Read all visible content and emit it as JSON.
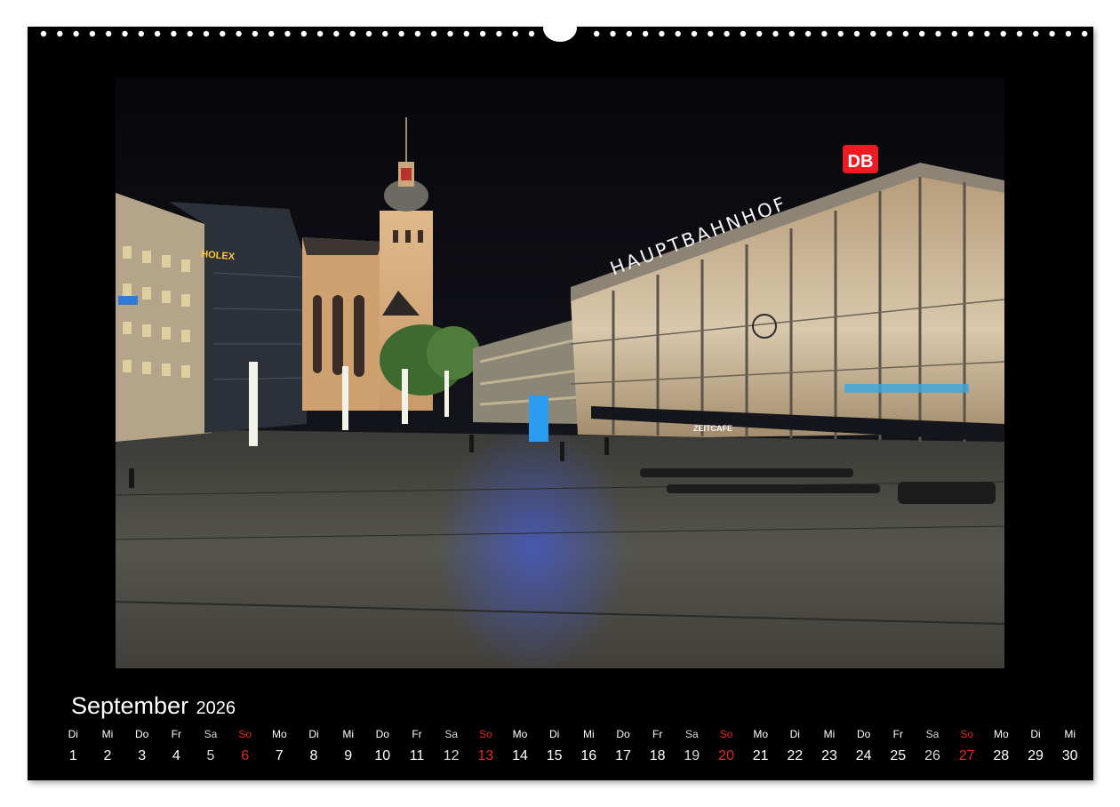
{
  "calendar": {
    "month": "September",
    "year": "2026",
    "colors": {
      "background": "#000000",
      "text": "#ffffff",
      "sunday": "#e32626"
    },
    "days": [
      {
        "weekday": "Di",
        "day": "1",
        "type": "weekday"
      },
      {
        "weekday": "Mi",
        "day": "2",
        "type": "weekday"
      },
      {
        "weekday": "Do",
        "day": "3",
        "type": "weekday"
      },
      {
        "weekday": "Fr",
        "day": "4",
        "type": "weekday"
      },
      {
        "weekday": "Sa",
        "day": "5",
        "type": "saturday"
      },
      {
        "weekday": "So",
        "day": "6",
        "type": "sunday"
      },
      {
        "weekday": "Mo",
        "day": "7",
        "type": "weekday"
      },
      {
        "weekday": "Di",
        "day": "8",
        "type": "weekday"
      },
      {
        "weekday": "Mi",
        "day": "9",
        "type": "weekday"
      },
      {
        "weekday": "Do",
        "day": "10",
        "type": "weekday"
      },
      {
        "weekday": "Fr",
        "day": "11",
        "type": "weekday"
      },
      {
        "weekday": "Sa",
        "day": "12",
        "type": "saturday"
      },
      {
        "weekday": "So",
        "day": "13",
        "type": "sunday"
      },
      {
        "weekday": "Mo",
        "day": "14",
        "type": "weekday"
      },
      {
        "weekday": "Di",
        "day": "15",
        "type": "weekday"
      },
      {
        "weekday": "Mi",
        "day": "16",
        "type": "weekday"
      },
      {
        "weekday": "Do",
        "day": "17",
        "type": "weekday"
      },
      {
        "weekday": "Fr",
        "day": "18",
        "type": "weekday"
      },
      {
        "weekday": "Sa",
        "day": "19",
        "type": "saturday"
      },
      {
        "weekday": "So",
        "day": "20",
        "type": "sunday"
      },
      {
        "weekday": "Mo",
        "day": "21",
        "type": "weekday"
      },
      {
        "weekday": "Di",
        "day": "22",
        "type": "weekday"
      },
      {
        "weekday": "Mi",
        "day": "23",
        "type": "weekday"
      },
      {
        "weekday": "Do",
        "day": "24",
        "type": "weekday"
      },
      {
        "weekday": "Fr",
        "day": "25",
        "type": "weekday"
      },
      {
        "weekday": "Sa",
        "day": "26",
        "type": "saturday"
      },
      {
        "weekday": "So",
        "day": "27",
        "type": "sunday"
      },
      {
        "weekday": "Mo",
        "day": "28",
        "type": "weekday"
      },
      {
        "weekday": "Di",
        "day": "29",
        "type": "weekday"
      },
      {
        "weekday": "Mi",
        "day": "30",
        "type": "weekday"
      }
    ]
  },
  "photo": {
    "station_sign": "HAUPTBAHNHOF",
    "db_logo": "DB",
    "shop_sign": "HOLEX",
    "cafe_sign": "ZEITCAFE"
  }
}
